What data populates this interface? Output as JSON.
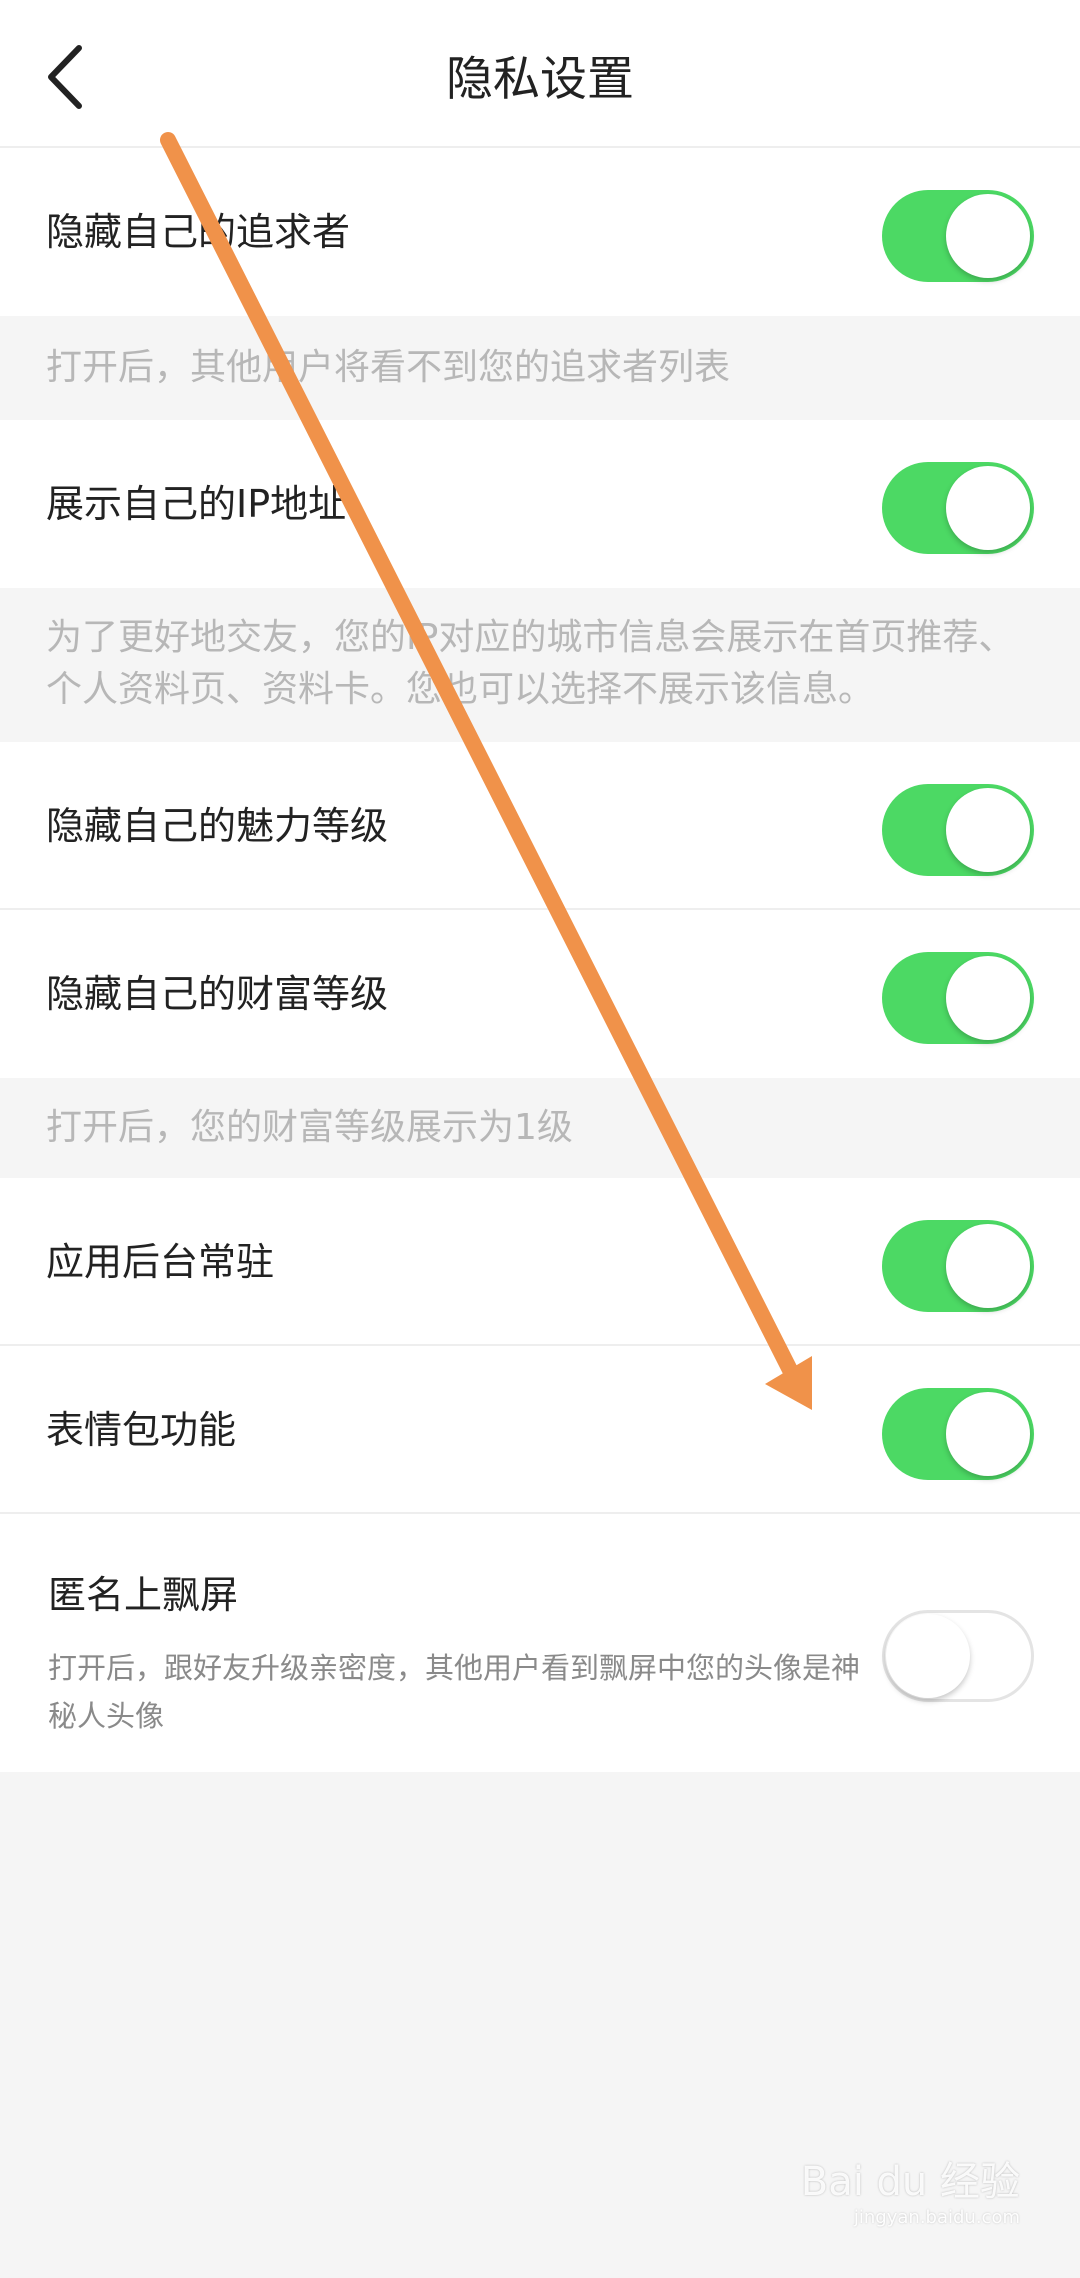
{
  "header": {
    "title": "隐私设置",
    "back_icon": "chevron-left-icon"
  },
  "settings": [
    {
      "label": "隐藏自己的追求者",
      "enabled": true
    },
    {
      "label": "展示自己的IP地址",
      "enabled": true
    },
    {
      "label": "隐藏自己的魅力等级",
      "enabled": true
    },
    {
      "label": "隐藏自己的财富等级",
      "enabled": true
    },
    {
      "label": "应用后台常驻",
      "enabled": true
    },
    {
      "label": "表情包功能",
      "enabled": true
    },
    {
      "label": "匿名上飘屏",
      "description": "打开后，跟好友升级亲密度，其他用户看到飘屏中您的头像是神秘人头像",
      "enabled": false
    }
  ],
  "notes": {
    "pursuers": "打开后，其他用户将看不到您的追求者列表",
    "ip": "为了更好地交友，您的IP对应的城市信息会展示在首页推荐、个人资料页、资料卡。您也可以选择不展示该信息。",
    "wealth": "打开后，您的财富等级展示为1级"
  },
  "colors": {
    "switch_on": "#4cd964",
    "annotation_arrow": "#f0924a"
  },
  "watermark": {
    "brand": "Bai du 经验",
    "url": "jingyan.baidu.com"
  }
}
